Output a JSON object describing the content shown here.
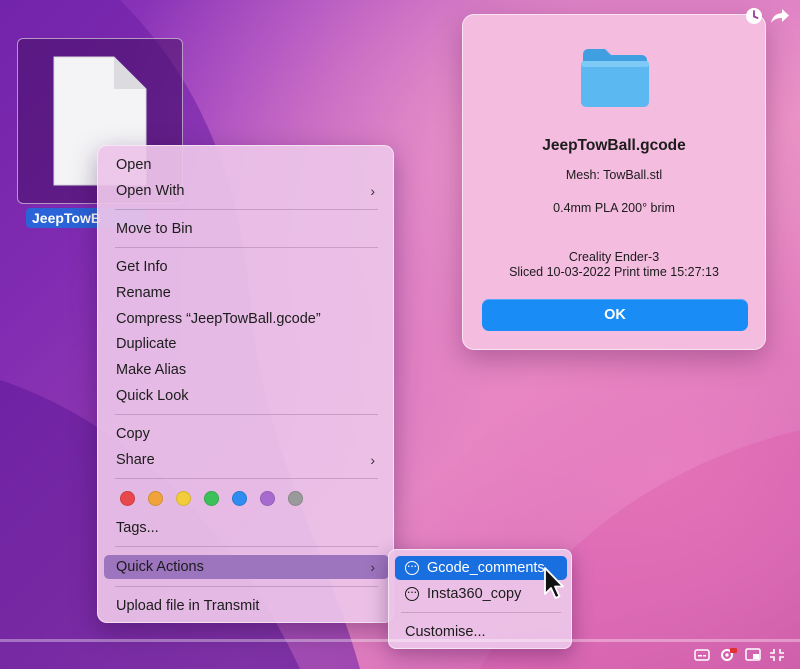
{
  "desktop": {
    "file_label": "JeepTowB"
  },
  "context_menu": {
    "items": [
      {
        "label": "Open"
      },
      {
        "label": "Open With"
      },
      {
        "label": "Move to Bin"
      },
      {
        "label": "Get Info"
      },
      {
        "label": "Rename"
      },
      {
        "label": "Compress “JeepTowBall.gcode”"
      },
      {
        "label": "Duplicate"
      },
      {
        "label": "Make Alias"
      },
      {
        "label": "Quick Look"
      },
      {
        "label": "Copy"
      },
      {
        "label": "Share"
      },
      {
        "label": "Tags..."
      },
      {
        "label": "Quick Actions"
      },
      {
        "label": "Upload file in Transmit"
      }
    ],
    "tag_colors": [
      "#e8474c",
      "#f0a33a",
      "#f2cc3a",
      "#3cc15a",
      "#2f8cf0",
      "#a76bd0",
      "#9a9a9a"
    ],
    "highlight_color": "#9d74be"
  },
  "submenu": {
    "items": [
      {
        "label": "Gcode_comments"
      },
      {
        "label": "Insta360_copy"
      },
      {
        "label": "Customise..."
      }
    ],
    "selected_color": "#1a6fe0"
  },
  "dialog": {
    "title": "JeepTowBall.gcode",
    "lines": [
      "Mesh: TowBall.stl",
      "0.4mm PLA 200° brim",
      "Creality Ender-3",
      "Sliced 10-03-2022   Print time 15:27:13"
    ],
    "ok_label": "OK",
    "accent": "#1a8cf5"
  }
}
